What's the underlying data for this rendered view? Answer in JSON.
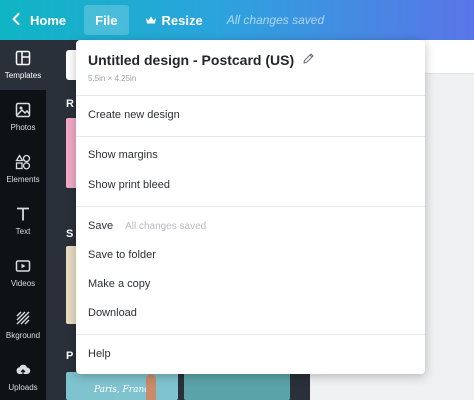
{
  "topbar": {
    "home_label": "Home",
    "file_label": "File",
    "resize_label": "Resize",
    "saved_status": "All changes saved"
  },
  "sidebar": {
    "items": [
      {
        "label": "Templates",
        "icon": "templates-icon"
      },
      {
        "label": "Photos",
        "icon": "photos-icon"
      },
      {
        "label": "Elements",
        "icon": "elements-icon"
      },
      {
        "label": "Text",
        "icon": "text-icon"
      },
      {
        "label": "Videos",
        "icon": "videos-icon"
      },
      {
        "label": "Bkground",
        "icon": "background-icon"
      },
      {
        "label": "Uploads",
        "icon": "uploads-icon"
      }
    ]
  },
  "panel": {
    "heading_1": "R",
    "heading_2": "S",
    "heading_3": "P",
    "thumb_text_1": "Paris, France"
  },
  "menu": {
    "title": "Untitled design - Postcard (US)",
    "subtitle": "5.5in × 4.25in",
    "items": {
      "create_new": "Create new design",
      "show_margins": "Show margins",
      "show_bleed": "Show print bleed",
      "save": "Save",
      "save_note": "All changes saved",
      "save_folder": "Save to folder",
      "make_copy": "Make a copy",
      "download": "Download",
      "help": "Help"
    }
  },
  "colors": {
    "topbar_gradient_start": "#0fb5c4",
    "topbar_gradient_end": "#5a75e8",
    "sidebar_bg": "#0d1216",
    "panel_bg": "#293039"
  }
}
